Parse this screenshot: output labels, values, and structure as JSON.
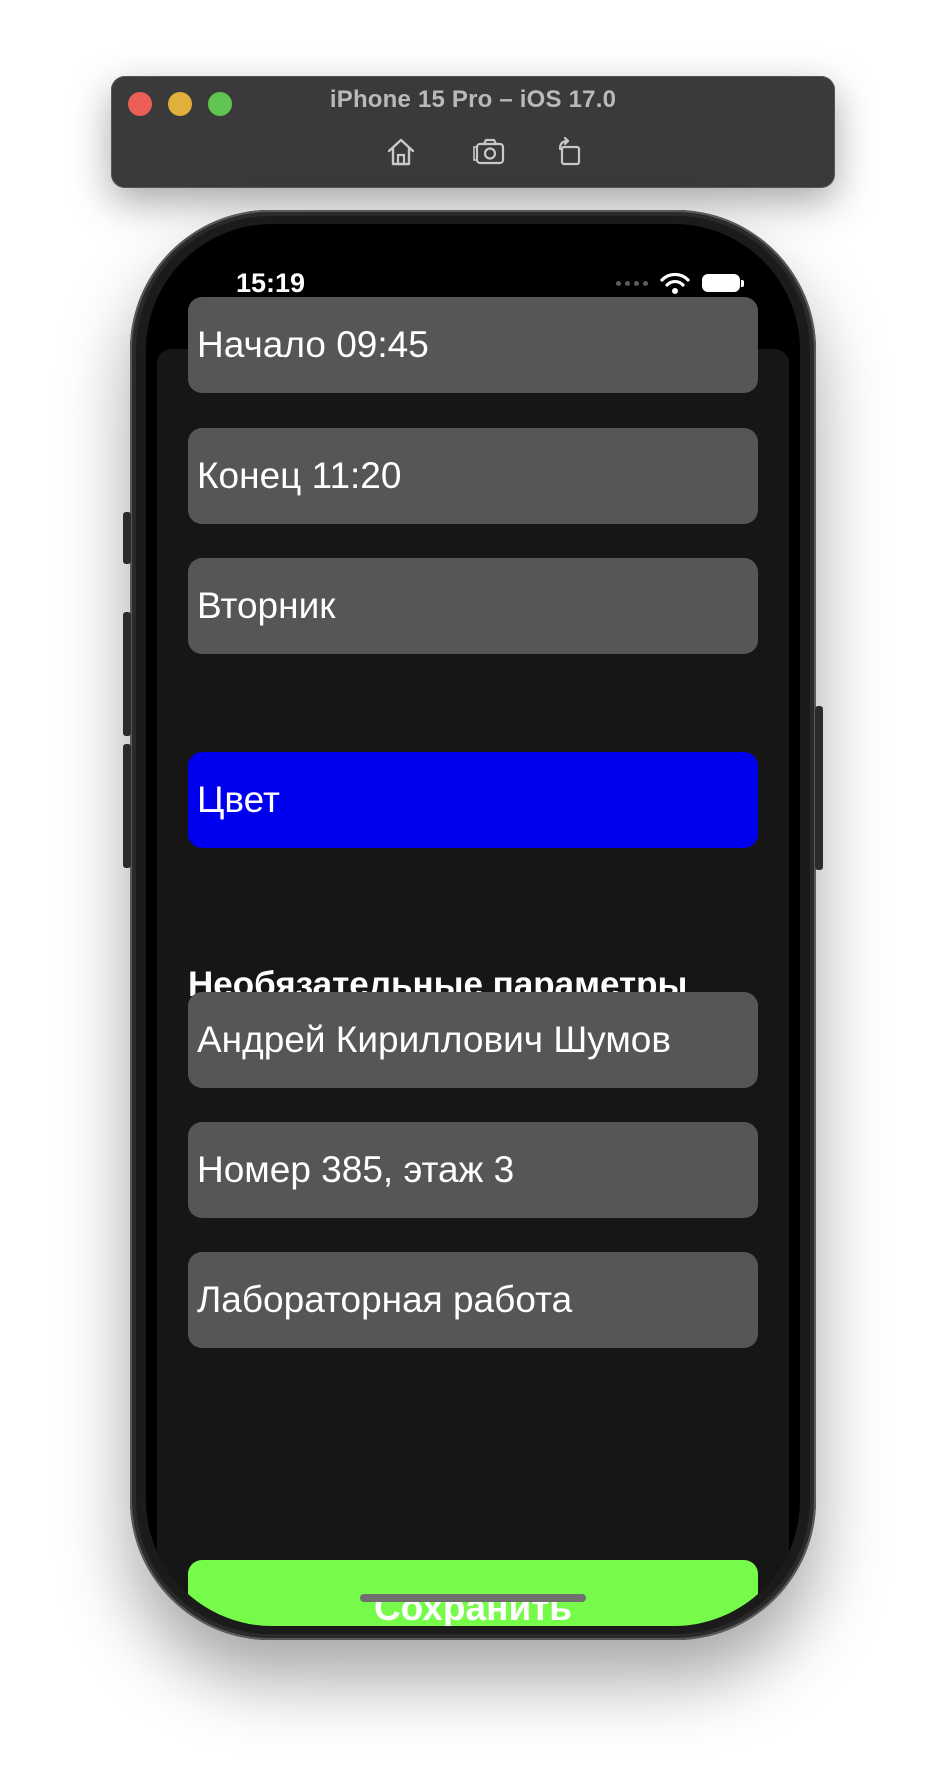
{
  "simulator": {
    "title": "iPhone 15 Pro – iOS 17.0",
    "tools": [
      {
        "icon": "home-icon"
      },
      {
        "icon": "screenshot-icon"
      },
      {
        "icon": "rotate-icon"
      }
    ]
  },
  "status_bar": {
    "time": "15:19",
    "icons": [
      "cellular-signal-icon",
      "wifi-icon",
      "battery-icon"
    ]
  },
  "form": {
    "start_field": "Начало 09:45",
    "end_field": "Конец 11:20",
    "weekday_field": "Вторник",
    "color_field": "Цвет",
    "color_value": "#0000f0",
    "optional_section_title": "Необязательные параметры",
    "teacher_field": "Андрей Кириллович Шумов",
    "room_field": "Номер 385, этаж 3",
    "type_field": "Лабораторная работа",
    "save_label": "Сохранить",
    "save_color": "#77fb4b"
  }
}
